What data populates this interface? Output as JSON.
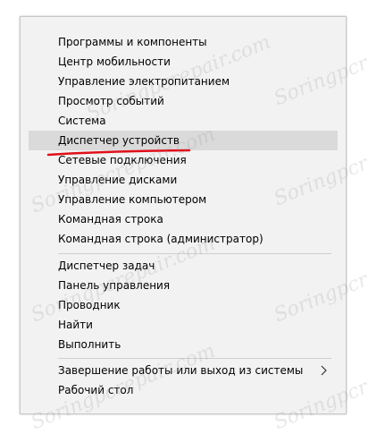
{
  "menu": {
    "items": [
      {
        "label": "Программы и компоненты"
      },
      {
        "label": "Центр мобильности"
      },
      {
        "label": "Управление электропитанием"
      },
      {
        "label": "Просмотр событий"
      },
      {
        "label": "Система"
      },
      {
        "label": "Диспетчер устройств",
        "highlighted": true
      },
      {
        "label": "Сетевые подключения"
      },
      {
        "label": "Управление дисками"
      },
      {
        "label": "Управление компьютером"
      },
      {
        "label": "Командная строка"
      },
      {
        "label": "Командная строка (администратор)"
      },
      {
        "label": "Диспетчер задач"
      },
      {
        "label": "Панель управления"
      },
      {
        "label": "Проводник"
      },
      {
        "label": "Найти"
      },
      {
        "label": "Выполнить"
      },
      {
        "label": "Завершение работы или выход из системы",
        "has_submenu": true
      },
      {
        "label": "Рабочий стол"
      }
    ]
  },
  "watermark": {
    "text": "Soringpcrepair.com"
  },
  "colors": {
    "menu_background": "#f2f2f2",
    "highlight": "#dadada",
    "annotation_underline": "#e0101a",
    "separator": "#cfcfcf"
  },
  "icons": {
    "submenu": "chevron-right-icon"
  }
}
